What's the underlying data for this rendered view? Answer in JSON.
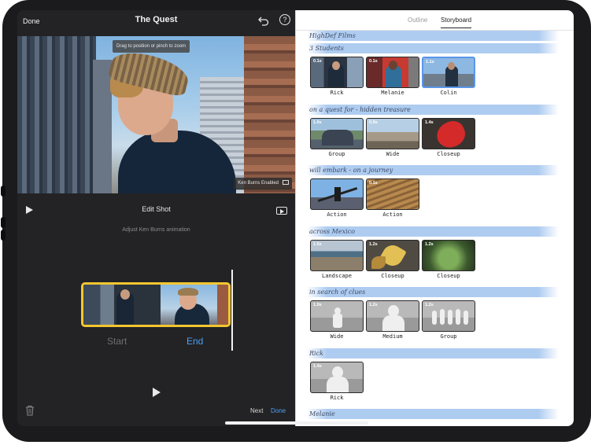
{
  "left": {
    "topbar": {
      "done": "Done",
      "title": "The Quest",
      "help": "?"
    },
    "preview": {
      "hint": "Drag to position or pinch to zoom",
      "ken_burns": "Ken Burns Enabled"
    },
    "control": {
      "title": "Edit Shot",
      "subtitle": "Adjust Ken Burns animation"
    },
    "range": {
      "start": "Start",
      "end": "End"
    },
    "bottom": {
      "next": "Next",
      "done": "Done"
    }
  },
  "right": {
    "tabs": [
      "Outline",
      "Storyboard"
    ],
    "active_tab": "Storyboard",
    "sections": [
      {
        "header": "HighDef Films",
        "clips": []
      },
      {
        "header": "3 Students",
        "clips": [
          {
            "duration": "0.1s",
            "caption": "Rick"
          },
          {
            "duration": "0.1s",
            "caption": "Melanie"
          },
          {
            "duration": "1.1s",
            "caption": "Colin",
            "selected": true
          }
        ]
      },
      {
        "header": "on a quest for - hidden treasure",
        "clips": [
          {
            "duration": "1.0s",
            "caption": "Group"
          },
          {
            "duration": "0.9s",
            "caption": "Wide"
          },
          {
            "duration": "1.4s",
            "caption": "Closeup"
          }
        ]
      },
      {
        "header": "will embark - on a journey",
        "clips": [
          {
            "duration": "",
            "caption": "Action"
          },
          {
            "duration": "0.1s",
            "caption": "Action"
          }
        ]
      },
      {
        "header": "across Mexico",
        "clips": [
          {
            "duration": "1.5s",
            "caption": "Landscape"
          },
          {
            "duration": "1.2s",
            "caption": "Closeup"
          },
          {
            "duration": "1.2s",
            "caption": "Closeup"
          }
        ]
      },
      {
        "header": "in search of clues",
        "clips": [
          {
            "duration": "1.0s",
            "caption": "Wide"
          },
          {
            "duration": "1.2s",
            "caption": "Medium"
          },
          {
            "duration": "1.2s",
            "caption": "Group"
          }
        ]
      },
      {
        "header": "Rick",
        "clips": [
          {
            "duration": "1.4s",
            "caption": "Rick"
          }
        ]
      },
      {
        "header": "Melanie",
        "clips": []
      }
    ]
  },
  "colors": {
    "accent": "#4aa0f5",
    "selection": "#f3c630",
    "header_wash": "#a0c3ee"
  }
}
